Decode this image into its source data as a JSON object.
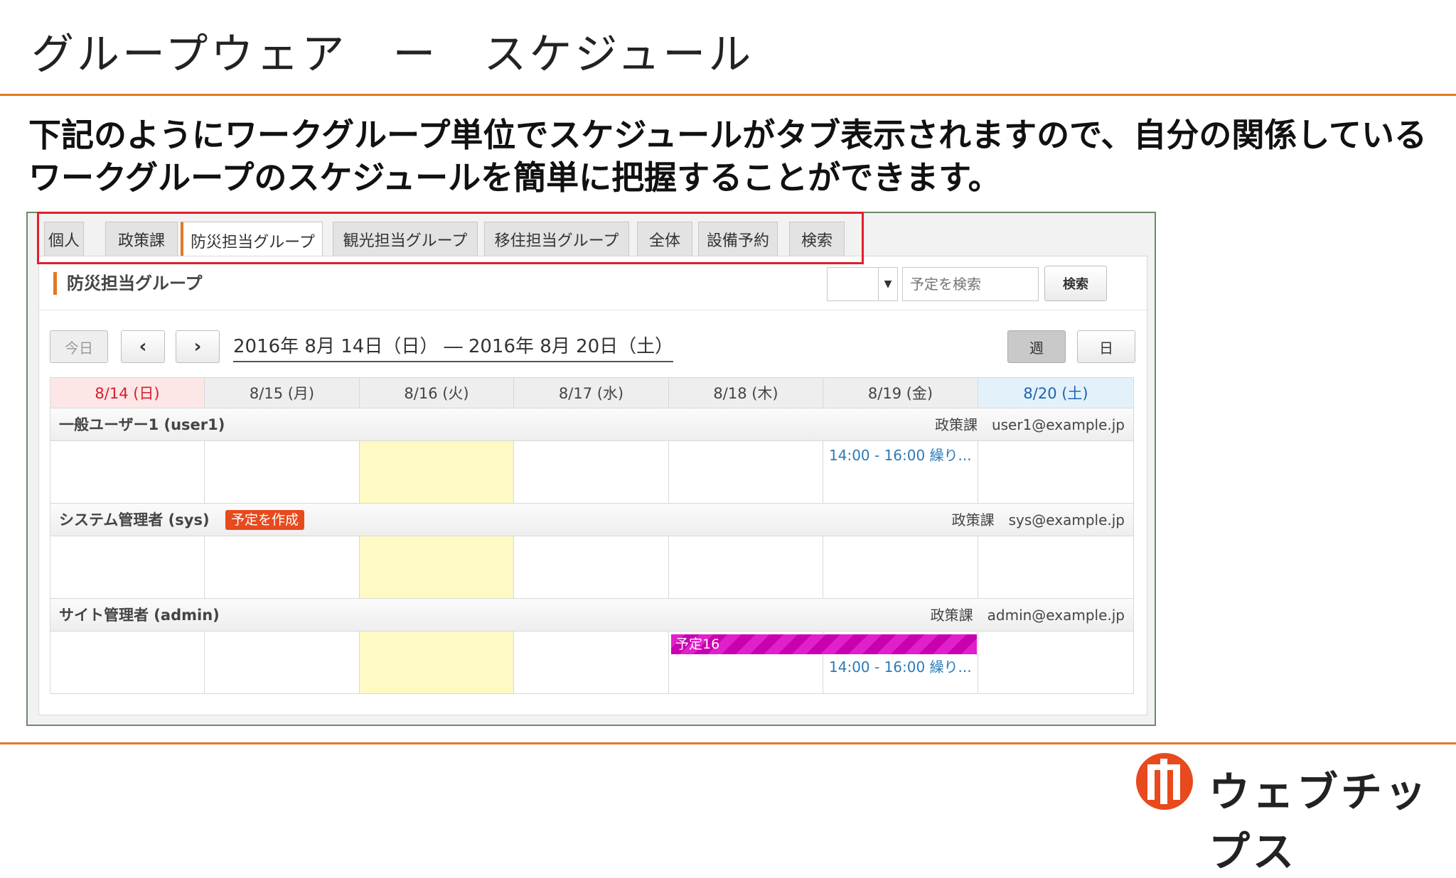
{
  "slide": {
    "title": "グループウェア　ー　スケジュール",
    "description": "下記のようにワークグループ単位でスケジュールがタブ表示されますので、自分の関係しているワークグループのスケジュールを簡単に把握することができます。",
    "brand": "ウェブチップス",
    "accent_color": "#e07a24"
  },
  "tabs": [
    {
      "label": "個人"
    },
    {
      "label": "政策課"
    },
    {
      "label": "防災担当グループ"
    },
    {
      "label": "観光担当グループ"
    },
    {
      "label": "移住担当グループ"
    },
    {
      "label": "全体"
    },
    {
      "label": "設備予約"
    },
    {
      "label": "検索"
    }
  ],
  "active_tab": "防災担当グループ",
  "panel": {
    "group_title": "防災担当グループ",
    "search_placeholder": "予定を検索",
    "search_button": "検索",
    "select_value": ""
  },
  "toolbar": {
    "today": "今日",
    "prev": "‹",
    "next": "›",
    "range": "2016年 8月 14日（日） ― 2016年 8月 20日（土）",
    "week": "週",
    "day": "日"
  },
  "days": [
    "8/14 (日)",
    "8/15 (月)",
    "8/16 (火)",
    "8/17 (水)",
    "8/18 (木)",
    "8/19 (金)",
    "8/20 (土)"
  ],
  "users": [
    {
      "name": "一般ユーザー1 (user1)",
      "dept": "政策課",
      "email": "user1@example.jp",
      "events": [
        {
          "text": "14:00 - 16:00 繰り...",
          "day": "8/19 (金)"
        }
      ]
    },
    {
      "name": "システム管理者 (sys)",
      "dept": "政策課",
      "email": "sys@example.jp",
      "badge": "予定を作成",
      "events": []
    },
    {
      "name": "サイト管理者 (admin)",
      "dept": "政策課",
      "email": "admin@example.jp",
      "bar": {
        "text": "予定16",
        "from": "8/18 (木)",
        "to": "8/19 (金)",
        "color": "#e020c8"
      },
      "events": [
        {
          "text": "14:00 - 16:00 繰り...",
          "day": "8/19 (金)"
        }
      ]
    }
  ]
}
